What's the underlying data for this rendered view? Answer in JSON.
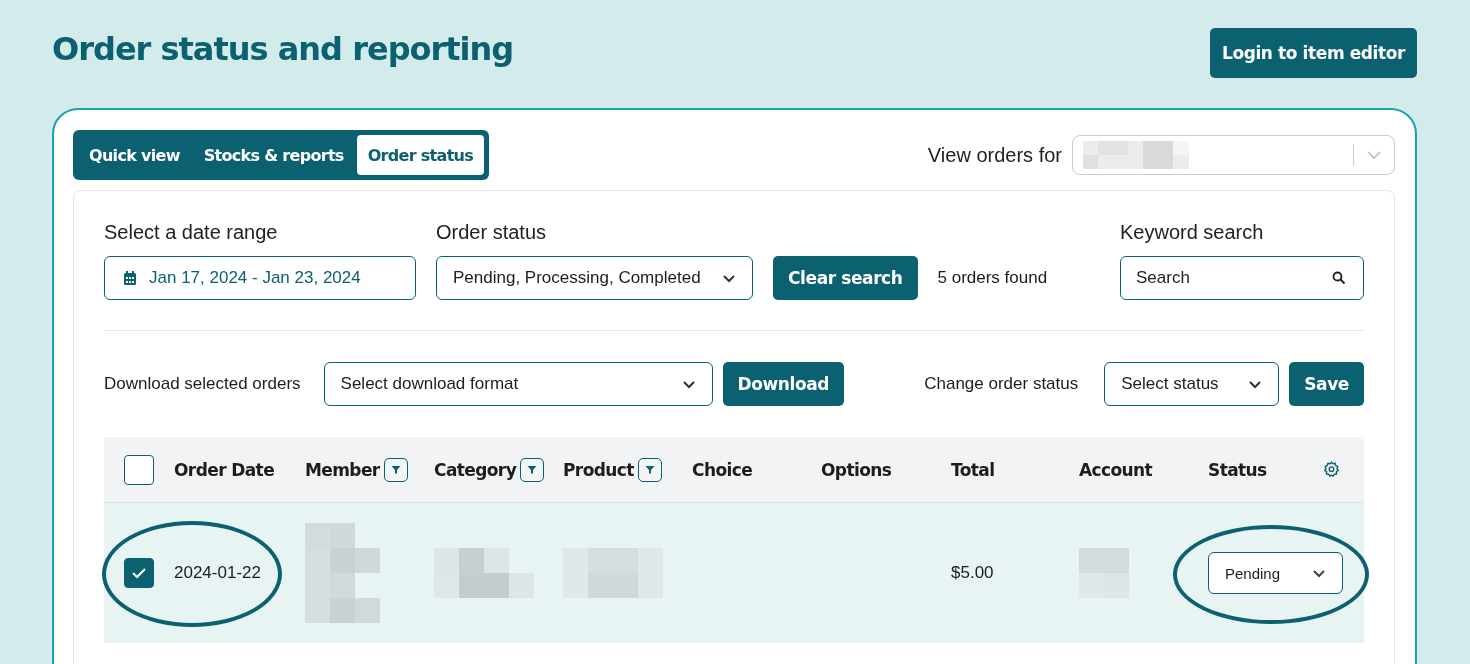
{
  "page": {
    "title": "Order status and reporting",
    "login_button": "Login to item editor"
  },
  "tabs": [
    {
      "label": "Quick view",
      "selected": false
    },
    {
      "label": "Stocks & reports",
      "selected": false
    },
    {
      "label": "Order status",
      "selected": true
    }
  ],
  "view_orders_for": {
    "label": "View orders for"
  },
  "filters": {
    "date_label": "Select a date range",
    "date_value": "Jan 17, 2024 - Jan 23, 2024",
    "status_label": "Order status",
    "status_value": "Pending, Processing, Completed",
    "clear_button": "Clear search",
    "result_count": "5 orders found",
    "keyword_label": "Keyword search",
    "keyword_placeholder": "Search"
  },
  "actions": {
    "download_label": "Download selected orders",
    "format_placeholder": "Select download format",
    "download_button": "Download",
    "change_status_label": "Change order status",
    "status_placeholder": "Select status",
    "save_button": "Save"
  },
  "table": {
    "select_all_checked": false,
    "columns": [
      {
        "label": "Order Date",
        "filter": false
      },
      {
        "label": "Member",
        "filter": true
      },
      {
        "label": "Category",
        "filter": true
      },
      {
        "label": "Product",
        "filter": true
      },
      {
        "label": "Choice",
        "filter": false
      },
      {
        "label": "Options",
        "filter": false
      },
      {
        "label": "Total",
        "filter": false
      },
      {
        "label": "Account",
        "filter": false
      },
      {
        "label": "Status",
        "filter": false
      }
    ],
    "rows": [
      {
        "checked": true,
        "order_date": "2024-01-22",
        "total": "$5.00",
        "status": "Pending",
        "circled": true
      }
    ]
  }
}
